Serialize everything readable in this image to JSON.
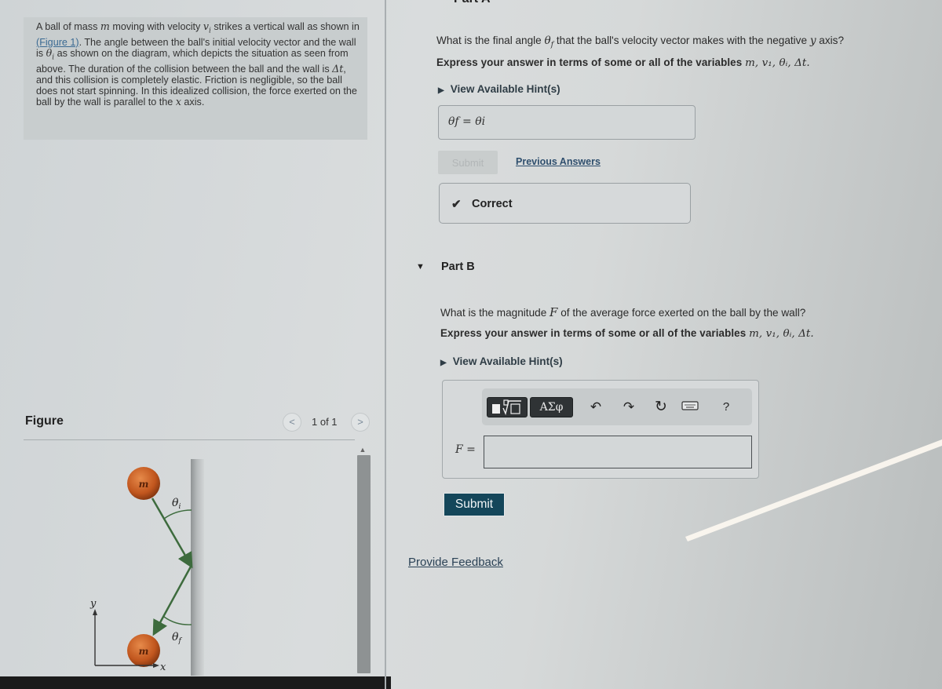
{
  "problem": {
    "text_parts": [
      "A ball of mass ",
      "m",
      " moving with velocity ",
      "v",
      " strikes a vertical wall as shown in ",
      "(Figure 1)",
      ". The angle between the ball's initial velocity vector and the wall is ",
      "θ",
      " as shown on the diagram, which depicts the situation as seen from above. The duration of the collision between the ball and the wall is ",
      "Δt",
      ", and this collision is completely elastic. Friction is negligible, so the ball does not start spinning. In this idealized collision, the force exerted on the ball by the wall is parallel to the ",
      "x",
      " axis."
    ],
    "subscript_i": "i"
  },
  "figure": {
    "title": "Figure",
    "pager": {
      "prev_icon": "chevron-left-icon",
      "next_icon": "chevron-right-icon",
      "count": "1 of 1"
    },
    "labels": {
      "mass_top": "m",
      "mass_bottom": "m",
      "theta_i": "θ",
      "theta_i_sub": "i",
      "theta_f": "θ",
      "theta_f_sub": "f",
      "axis_y": "y",
      "axis_x": "x"
    },
    "colors": {
      "ball": "#c1561e",
      "arrow": "#3d6b3d",
      "wall": "#a2a6a7"
    }
  },
  "part_a": {
    "title_fragment": "Part A",
    "question_pre": "What is the final angle ",
    "question_var": "θ",
    "question_var_sub": "f",
    "question_post": " that the ball's velocity vector makes with the negative ",
    "question_axis": "y",
    "question_end": " axis?",
    "instruction": "Express your answer in terms of some or all of the variables ",
    "variables": "m, v₁, θᵢ, Δt.",
    "hint_label": "View Available Hint(s)",
    "answer_display": "θf = θi",
    "submit_label": "Submit",
    "previous_answers_label": "Previous Answers",
    "result_label": "Correct"
  },
  "part_b": {
    "title": "Part B",
    "question_pre": "What is the magnitude ",
    "question_var": "F",
    "question_post": " of the average force exerted on the ball by the wall?",
    "instruction": "Express your answer in terms of some or all of the variables ",
    "variables": "m, v₁, θᵢ, Δt.",
    "hint_label": "View Available Hint(s)",
    "toolbar": {
      "templates_icon": "templates-sqrt-icon",
      "symbols_label": "ΑΣφ",
      "undo_icon": "undo-icon",
      "redo_icon": "redo-icon",
      "reset_icon": "reset-icon",
      "keyboard_icon": "keyboard-icon",
      "help_label": "?"
    },
    "input_label": "F =",
    "input_value": "",
    "submit_label": "Submit"
  },
  "feedback_link": "Provide Feedback",
  "accent_colors": {
    "submit_active": "#14465a",
    "link": "#2f4f6e"
  }
}
